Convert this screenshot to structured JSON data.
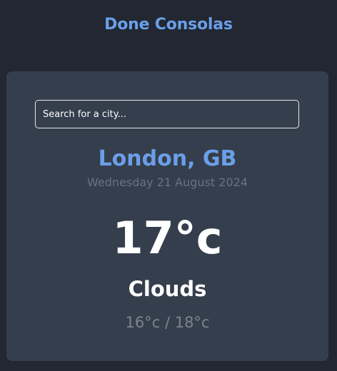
{
  "colors": {
    "accent": "#6a9fe8",
    "background": "#222732",
    "card": "#353e4c",
    "text": "#ffffff",
    "muted": "#6a7382"
  },
  "header": {
    "title": "Done Consolas"
  },
  "search": {
    "placeholder": "Search for a city..."
  },
  "weather": {
    "location": "London, GB",
    "date": "Wednesday 21 August 2024",
    "temperature": "17°c",
    "condition": "Clouds",
    "range": "16°c / 18°c"
  }
}
